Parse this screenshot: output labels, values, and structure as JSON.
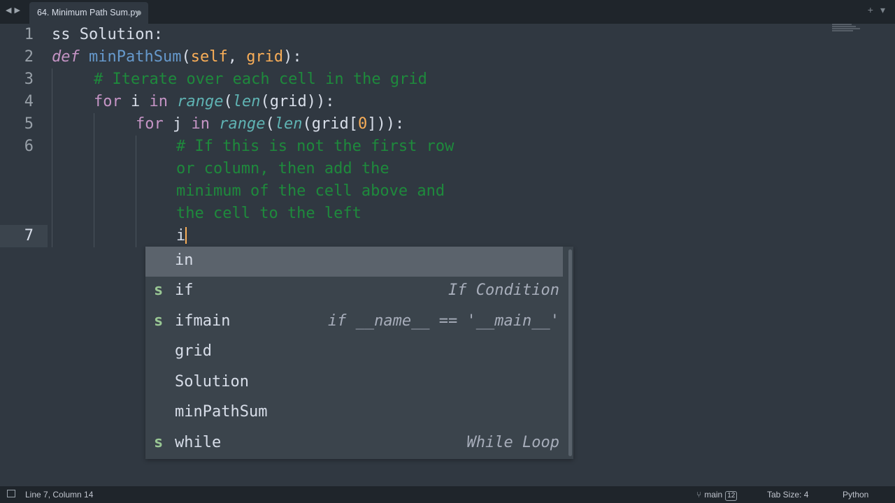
{
  "window": {
    "tab_title": "64. Minimum Path Sum.py",
    "nav_back_icon": "arrow-left",
    "nav_forward_icon": "arrow-right",
    "new_tab_icon": "plus",
    "tab_list_icon": "chevron-down"
  },
  "gutter": [
    "1",
    "2",
    "3",
    "4",
    "5",
    "6",
    "7"
  ],
  "code": {
    "l1_text": "ss Solution:",
    "l2_def": "def",
    "l2_fn": "minPathSum",
    "l2_open": "(",
    "l2_self": "self",
    "l2_comma": ", ",
    "l2_grid": "grid",
    "l2_close": "):",
    "l3_comment": "# Iterate over each cell in the grid",
    "l4_for": "for",
    "l4_i": " i ",
    "l4_in": "in",
    "l4_range": "range",
    "l4_p1": "(",
    "l4_len": "len",
    "l4_rest": "(grid)):",
    "l5_for": "for",
    "l5_j": " j ",
    "l5_in": "in",
    "l5_range": "range",
    "l5_p1": "(",
    "l5_len": "len",
    "l5_mid": "(grid[",
    "l5_zero": "0",
    "l5_end": "])):",
    "l6_comment_1": "# If this is not the first row",
    "l6_comment_2": "or column, then add the",
    "l6_comment_3": "minimum of the cell above and",
    "l6_comment_4": "the cell to the left",
    "l7_text": "i"
  },
  "autocomplete": {
    "items": [
      {
        "kind": "",
        "label": "in",
        "hint": ""
      },
      {
        "kind": "s",
        "label": "if",
        "hint": "If Condition"
      },
      {
        "kind": "s",
        "label": "ifmain",
        "hint": "if __name__ == '__main__'"
      },
      {
        "kind": "",
        "label": "grid",
        "hint": ""
      },
      {
        "kind": "",
        "label": "Solution",
        "hint": ""
      },
      {
        "kind": "",
        "label": "minPathSum",
        "hint": ""
      },
      {
        "kind": "s",
        "label": "while",
        "hint": "While Loop"
      }
    ]
  },
  "status": {
    "position": "Line 7, Column 14",
    "branch": "main",
    "branch_badge": "12",
    "tab_size": "Tab Size: 4",
    "syntax": "Python"
  },
  "colors": {
    "background": "#303841",
    "comment": "#1e8a3c",
    "keyword": "#c594c5",
    "function": "#6699cc",
    "parameter": "#f9ae58"
  }
}
